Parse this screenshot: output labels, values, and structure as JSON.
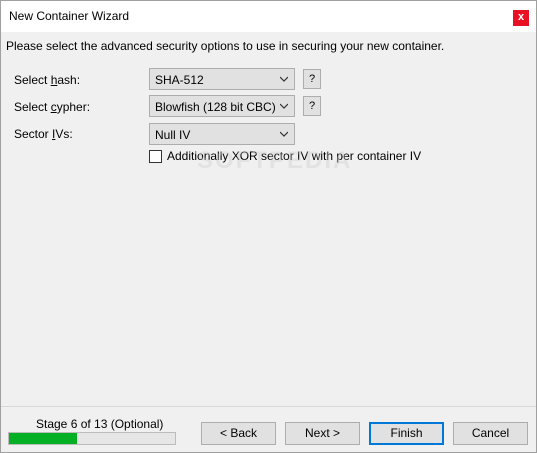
{
  "window": {
    "title": "New Container Wizard",
    "close_label": "x"
  },
  "intro": "Please select the advanced security options to use in securing your new container.",
  "fields": {
    "hash": {
      "label_pre": "Select ",
      "label_ul": "h",
      "label_post": "ash:",
      "value": "SHA-512",
      "help": "?"
    },
    "cypher": {
      "label_pre": "Select ",
      "label_ul": "c",
      "label_post": "ypher:",
      "value": "Blowfish (128 bit CBC)",
      "help": "?"
    },
    "sector_ivs": {
      "label_pre": "Sector ",
      "label_ul": "I",
      "label_post": "Vs:",
      "value": "Null IV"
    }
  },
  "xor_option": {
    "label": "Additionally XOR sector IV with per container IV",
    "checked": false
  },
  "watermark": "SOFTPEDIA",
  "footer": {
    "stage_text": "Stage 6 of 13 (Optional)",
    "progress": 0.41,
    "back_label": "< Back",
    "next_label": "Next >",
    "finish_label": "Finish",
    "cancel_label": "Cancel"
  },
  "colors": {
    "progress_fill": "#06b025",
    "close_button": "#e81123",
    "focus_border": "#0078d7"
  }
}
